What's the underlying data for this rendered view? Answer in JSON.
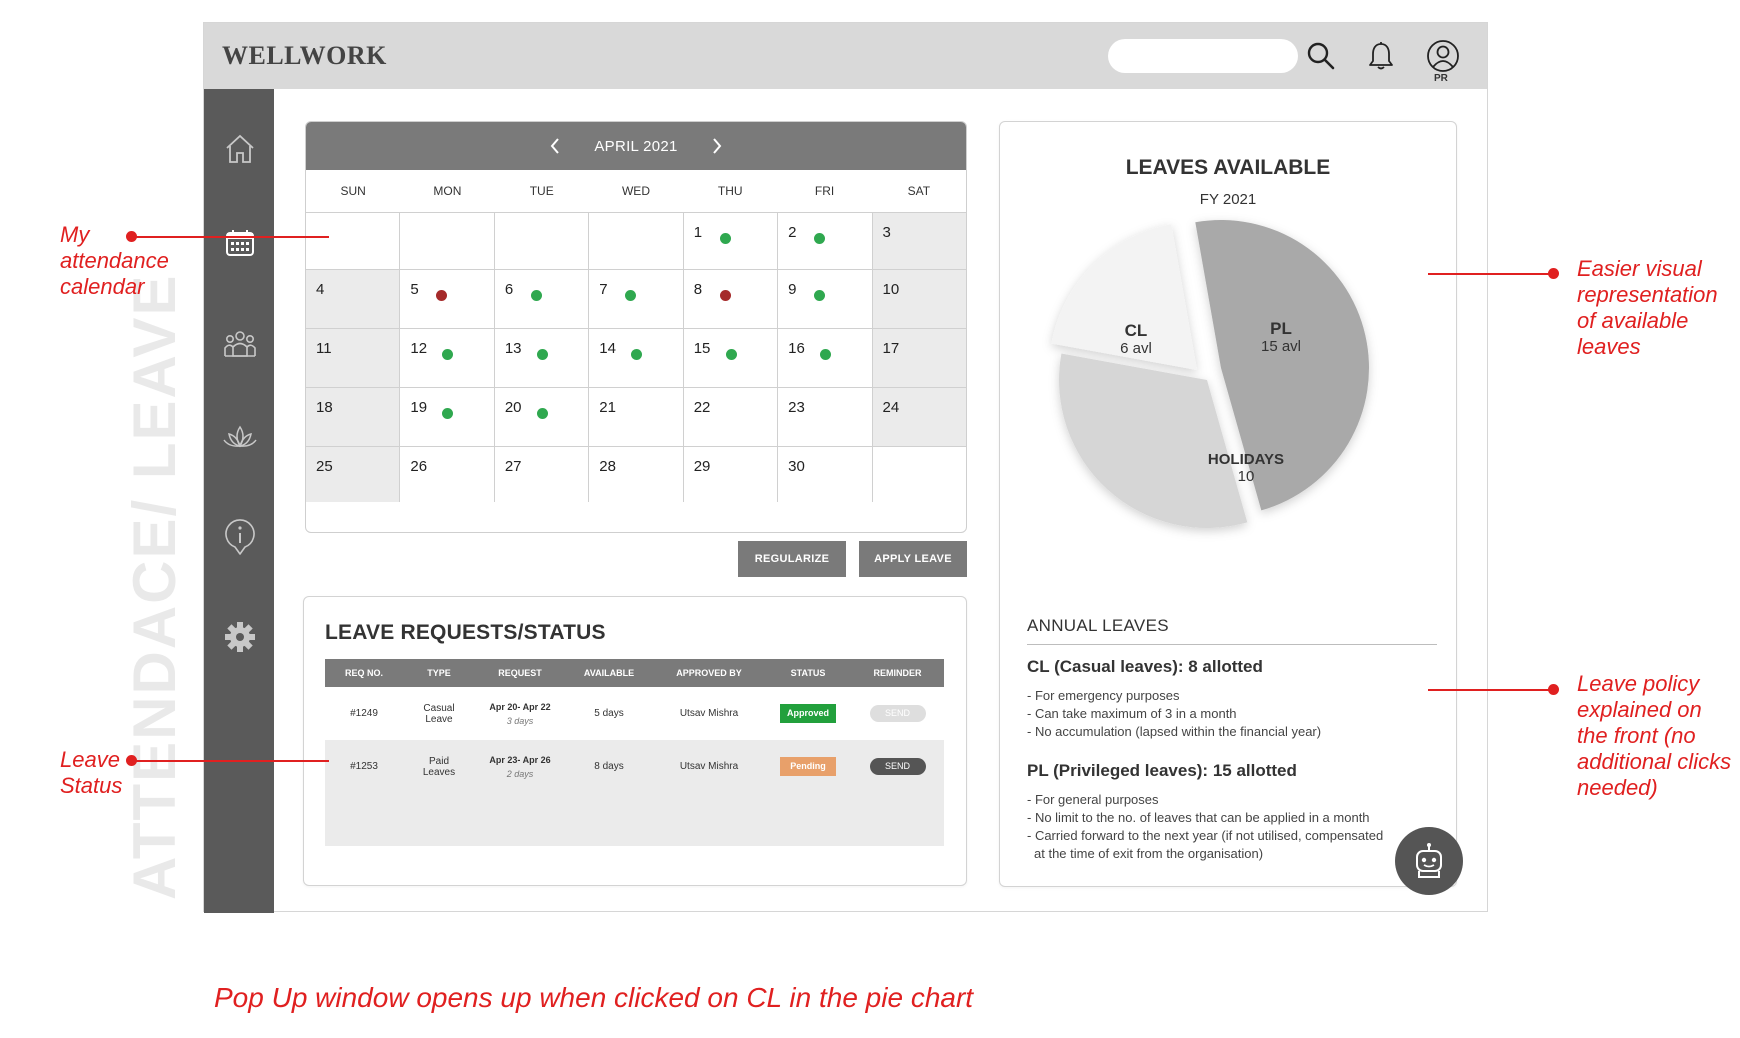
{
  "app": {
    "brand": "WELLWORK",
    "search_placeholder": "",
    "user_initials": "PR"
  },
  "page_label": "ATTENDACE/ LEAVE",
  "sidebar": {
    "items": [
      {
        "name": "home",
        "icon": "home-icon"
      },
      {
        "name": "calendar",
        "icon": "calendar-icon"
      },
      {
        "name": "team",
        "icon": "team-icon"
      },
      {
        "name": "wellness",
        "icon": "lotus-icon"
      },
      {
        "name": "info",
        "icon": "info-icon"
      },
      {
        "name": "settings",
        "icon": "gear-icon"
      }
    ]
  },
  "calendar": {
    "month": "APRIL 2021",
    "days_of_week": [
      "SUN",
      "MON",
      "TUE",
      "WED",
      "THU",
      "FRI",
      "SAT"
    ],
    "weeks": [
      [
        {
          "d": ""
        },
        {
          "d": ""
        },
        {
          "d": ""
        },
        {
          "d": ""
        },
        {
          "d": "1",
          "s": "present"
        },
        {
          "d": "2",
          "s": "present"
        },
        {
          "d": "3"
        }
      ],
      [
        {
          "d": "4"
        },
        {
          "d": "5",
          "s": "absent"
        },
        {
          "d": "6",
          "s": "present"
        },
        {
          "d": "7",
          "s": "present"
        },
        {
          "d": "8",
          "s": "absent"
        },
        {
          "d": "9",
          "s": "present"
        },
        {
          "d": "10"
        }
      ],
      [
        {
          "d": "11"
        },
        {
          "d": "12",
          "s": "present"
        },
        {
          "d": "13",
          "s": "present"
        },
        {
          "d": "14",
          "s": "present"
        },
        {
          "d": "15",
          "s": "present"
        },
        {
          "d": "16",
          "s": "present"
        },
        {
          "d": "17"
        }
      ],
      [
        {
          "d": "18"
        },
        {
          "d": "19",
          "s": "present"
        },
        {
          "d": "20",
          "s": "present"
        },
        {
          "d": "21"
        },
        {
          "d": "22"
        },
        {
          "d": "23"
        },
        {
          "d": "24"
        }
      ],
      [
        {
          "d": "25"
        },
        {
          "d": "26"
        },
        {
          "d": "27"
        },
        {
          "d": "28"
        },
        {
          "d": "29"
        },
        {
          "d": "30"
        },
        {
          "d": ""
        }
      ]
    ],
    "colors": {
      "present": "#2fa84f",
      "absent": "#a52a2a"
    }
  },
  "actions": {
    "regularize": "REGULARIZE",
    "apply_leave": "APPLY LEAVE"
  },
  "requests": {
    "title": "LEAVE REQUESTS/STATUS",
    "headers": [
      "REQ NO.",
      "TYPE",
      "REQUEST",
      "AVAILABLE",
      "APPROVED BY",
      "STATUS",
      "REMINDER"
    ],
    "rows": [
      {
        "req_no": "#1249",
        "type": "Casual Leave",
        "request": "Apr 20- Apr 22",
        "duration": "3 days",
        "available": "5 days",
        "approved_by": "Utsav Mishra",
        "status": "Approved",
        "status_color": "#22a03c",
        "reminder": "SEND",
        "reminder_enabled": false
      },
      {
        "req_no": "#1253",
        "type": "Paid Leaves",
        "request": "Apr 23- Apr 26",
        "duration": "2 days",
        "available": "8 days",
        "approved_by": "Utsav Mishra",
        "status": "Pending",
        "status_color": "#e8a06a",
        "reminder": "SEND",
        "reminder_enabled": true
      }
    ]
  },
  "leaves": {
    "title": "LEAVES AVAILABLE",
    "subtitle": "FY 2021",
    "annual_heading": "ANNUAL LEAVES",
    "cl_heading": "CL (Casual leaves): 8 allotted",
    "cl_points": [
      "- For emergency purposes",
      "- Can take maximum of 3 in a month",
      "- No accumulation (lapsed within the financial year)"
    ],
    "pl_heading": "PL (Privileged leaves): 15 allotted",
    "pl_points": [
      "- For general purposes",
      "- No limit to the no. of leaves that can be applied in a month",
      "- Carried forward to the next year (if not utilised, compensated",
      "  at the time of exit from the organisation)"
    ]
  },
  "chart_data": {
    "type": "pie",
    "title": "LEAVES AVAILABLE",
    "subtitle": "FY 2021",
    "slices": [
      {
        "label": "PL",
        "sublabel": "15 avl",
        "value": 15,
        "color": "#a9a9a9"
      },
      {
        "label": "HOLIDAYS",
        "sublabel": "10",
        "value": 10,
        "color": "#d6d6d6"
      },
      {
        "label": "CL",
        "sublabel": "6 avl",
        "value": 6,
        "color": "#f3f3f3"
      }
    ]
  },
  "annotations": {
    "calendar": "My attendance calendar",
    "status": "Leave Status",
    "visual": "Easier visual representation of available leaves",
    "policy": "Leave policy explained on the front (no additional clicks needed)",
    "footer": "Pop Up window opens up when clicked on CL in the pie chart",
    "color": "#e02020"
  }
}
